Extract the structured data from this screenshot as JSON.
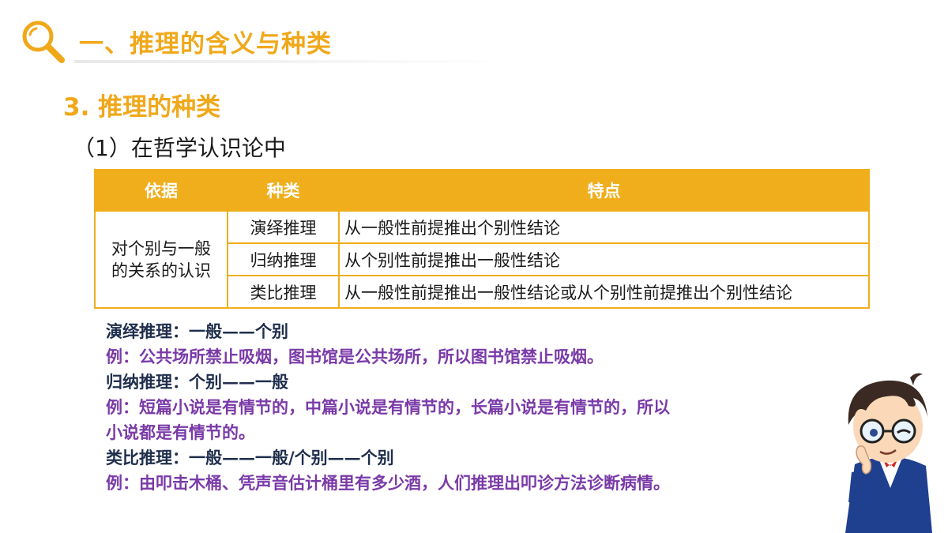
{
  "header": {
    "title": "一、推理的含义与种类",
    "icon": "search-icon",
    "accent_color": "#f0a81a"
  },
  "section": {
    "title": "3. 推理的种类",
    "subtitle": "（1）在哲学认识论中"
  },
  "table": {
    "headers": [
      "依据",
      "种类",
      "特点"
    ],
    "basis": [
      "对个别与一般",
      "的关系的认识"
    ],
    "rows": [
      {
        "kind": "演绎推理",
        "feature": "从一般性前提推出个别性结论"
      },
      {
        "kind": "归纳推理",
        "feature": "从个别性前提推出一般性结论"
      },
      {
        "kind": "类比推理",
        "feature": "从一般性前提推出一般性结论或从个别性前提推出个别性结论"
      }
    ]
  },
  "notes": [
    {
      "type": "rule",
      "text": "演绎推理：一般——个别"
    },
    {
      "type": "example",
      "text": "例：公共场所禁止吸烟，图书馆是公共场所，所以图书馆禁止吸烟。"
    },
    {
      "type": "rule",
      "text": "归纳推理：个别——一般"
    },
    {
      "type": "example",
      "text": "例：短篇小说是有情节的，中篇小说是有情节的，长篇小说是有情节的，所以"
    },
    {
      "type": "example",
      "text": "小说都是有情节的。"
    },
    {
      "type": "rule",
      "text": "类比推理：一般——一般/个别——个别"
    },
    {
      "type": "example",
      "text": "例：由叩击木桶、凭声音估计桶里有多少酒，人们推理出叩诊方法诊断病情。"
    }
  ],
  "illustration": "cartoon-detective-illustration"
}
